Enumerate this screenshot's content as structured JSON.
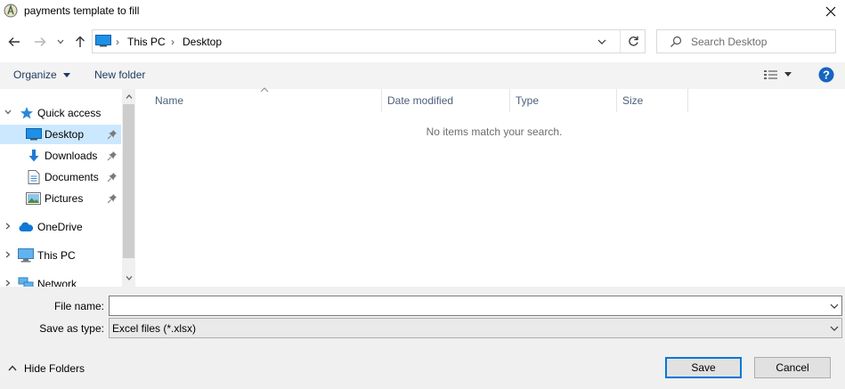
{
  "window": {
    "title": "payments template to fill"
  },
  "address": {
    "crumbs": [
      "This PC",
      "Desktop"
    ]
  },
  "search": {
    "placeholder": "Search Desktop"
  },
  "toolbar": {
    "organize": "Organize",
    "new_folder": "New folder"
  },
  "nav": {
    "items": [
      {
        "label": "Quick access",
        "icon": "star-icon"
      },
      {
        "label": "Desktop",
        "icon": "desktop-icon",
        "selected": true,
        "pinned": true
      },
      {
        "label": "Downloads",
        "icon": "download-icon",
        "pinned": true
      },
      {
        "label": "Documents",
        "icon": "document-icon",
        "pinned": true
      },
      {
        "label": "Pictures",
        "icon": "pictures-icon",
        "pinned": true
      },
      {
        "label": "OneDrive",
        "icon": "cloud-icon"
      },
      {
        "label": "This PC",
        "icon": "computer-icon"
      },
      {
        "label": "Network",
        "icon": "network-icon"
      }
    ]
  },
  "columns": [
    "Name",
    "Date modified",
    "Type",
    "Size"
  ],
  "content": {
    "empty_message": "No items match your search."
  },
  "bottom": {
    "file_name_label": "File name:",
    "file_name_value": "",
    "save_type_label": "Save as type:",
    "save_type_value": "Excel files (*.xlsx)",
    "hide_folders": "Hide Folders",
    "save": "Save",
    "cancel": "Cancel"
  },
  "colors": {
    "accent": "#0078d7",
    "selection": "#cce8ff",
    "toolbar_bg": "#f3f3f3",
    "bottom_bg": "#f0f0f0"
  }
}
